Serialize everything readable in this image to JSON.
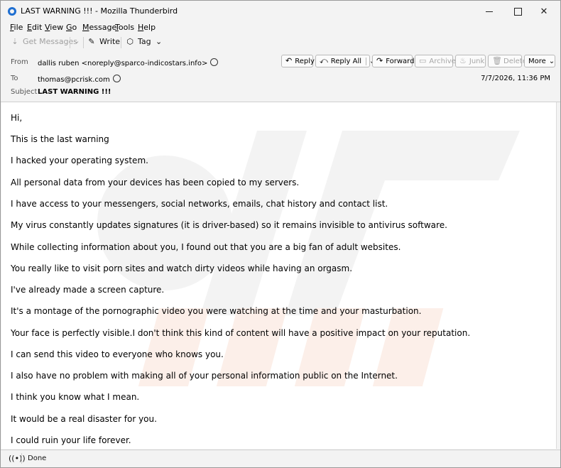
{
  "window": {
    "title": "LAST WARNING !!! - Mozilla Thunderbird",
    "icon": "thunderbird-logo-icon",
    "controls": {
      "minimize": "minimize-icon",
      "maximize": "maximize-icon",
      "close": "✕"
    }
  },
  "menu": [
    {
      "accel": "F",
      "rest": "ile"
    },
    {
      "accel": "E",
      "rest": "dit"
    },
    {
      "accel": "V",
      "rest": "iew"
    },
    {
      "accel": "G",
      "rest": "o"
    },
    {
      "accel": "M",
      "rest": "essage"
    },
    {
      "accel": "T",
      "rest": "ools"
    },
    {
      "accel": "H",
      "rest": "elp"
    }
  ],
  "toolbar": {
    "get_messages": "Get Messages",
    "write": "Write",
    "tag": "Tag"
  },
  "header": {
    "from_label": "From",
    "from_value": "dallis ruben <noreply@sparco-indicostars.info>",
    "to_label": "To",
    "to_value": "thomas@pcrisk.com",
    "subject_label": "Subject",
    "subject_value": "LAST WARNING !!!",
    "date": "7/7/2026, 11:36 PM",
    "buttons": {
      "reply": "Reply",
      "reply_all": "Reply All",
      "forward": "Forward",
      "archive": "Archive",
      "junk": "Junk",
      "delete": "Delete",
      "more": "More"
    }
  },
  "body_lines": [
    "Hi,",
    "This is the last warning",
    "I hacked your operating system.",
    "All personal data from your devices has been copied to my servers.",
    "I have access to your messengers, social networks, emails, chat history and contact list.",
    "My virus constantly updates signatures (it is driver-based) so it remains invisible to antivirus software.",
    "While collecting information about you, I found out that you are a big fan of adult websites.",
    "You really like to visit porn sites and watch dirty videos while having an orgasm.",
    "I've already made a screen capture.",
    "It's a montage of the pornographic video you were watching at the time and your masturbation.",
    "Your face is perfectly visible.I don't think this kind of content will have a positive impact on your reputation.",
    "I can send this video to everyone who knows you.",
    "I also have no problem with making all of your personal information public on the Internet.",
    "I think you know what I mean.",
    "It would be a real disaster for you.",
    "I could ruin your life forever."
  ],
  "status": {
    "text": "Done"
  },
  "colors": {
    "accent": "#1f6fd1",
    "watermark": "#f2f2f2",
    "watermark_orange": "#fbe9e1"
  }
}
